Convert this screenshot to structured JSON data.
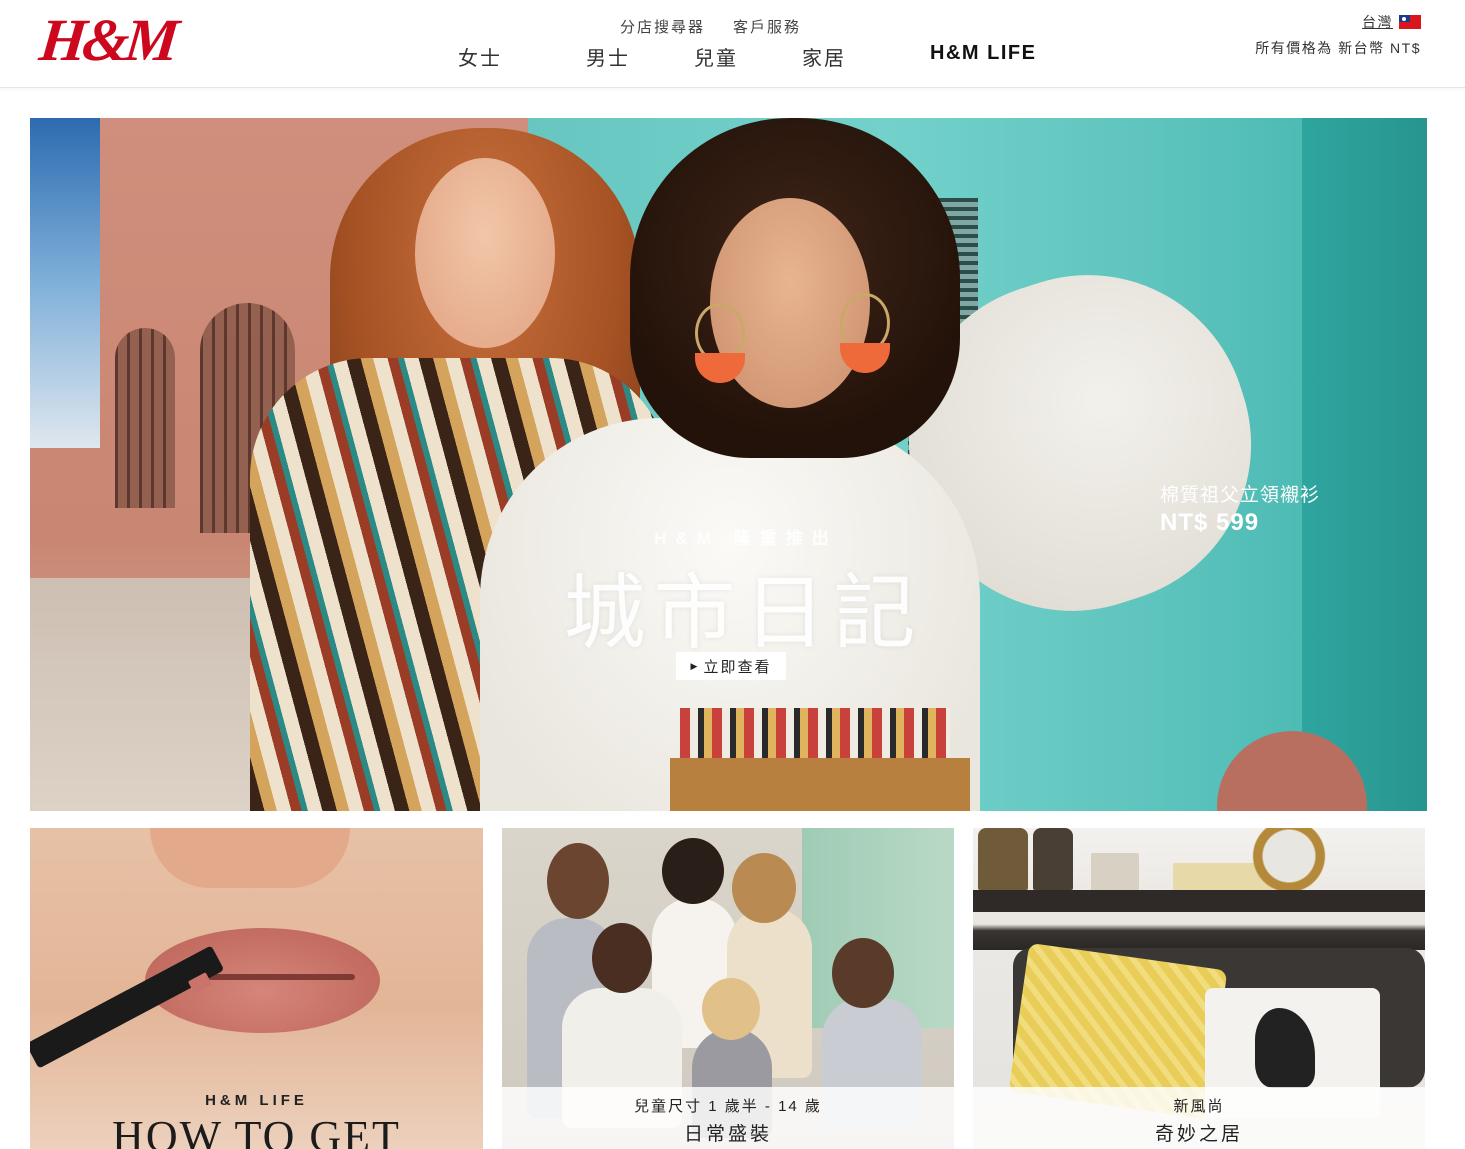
{
  "brand": {
    "logo_text": "H&M",
    "logo_color": "#cc071e"
  },
  "utility_links": [
    {
      "label": "分店搜尋器"
    },
    {
      "label": "客戶服務"
    }
  ],
  "main_nav": [
    {
      "label": "女士"
    },
    {
      "label": "男士"
    },
    {
      "label": "兒童"
    },
    {
      "label": "家居"
    },
    {
      "label": "H&M LIFE"
    }
  ],
  "region": {
    "country": "台灣",
    "flag_icon": "taiwan-flag-icon",
    "currency_note": "所有價格為 新台幣 NT$"
  },
  "hero": {
    "kicker": "H&M 隆重推出",
    "title": "城市日記",
    "cta_label": "立即查看",
    "cta_icon": "triangle-right-icon",
    "product_name": "棉質祖父立領襯衫",
    "product_price": "NT$ 599"
  },
  "tiles": {
    "life": {
      "kicker": "H&M LIFE",
      "title": "HOW TO GET"
    },
    "kids": {
      "line1": "兒童尺寸 1 歲半 - 14 歲",
      "line2": "日常盛裝"
    },
    "home": {
      "line1": "新風尚",
      "line2": "奇妙之居"
    }
  }
}
